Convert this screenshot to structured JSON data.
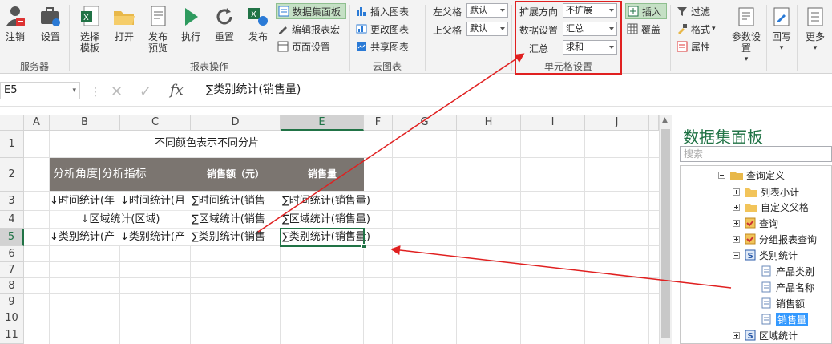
{
  "ribbon": {
    "server": {
      "logout": "注销",
      "settings": "设置",
      "group": "服务器"
    },
    "report": {
      "select_template": "选择\n模板",
      "open": "打开",
      "publish_preview": "发布\n预览",
      "execute": "执行",
      "reset": "重置",
      "publish": "发布",
      "dataset_panel": "数据集面板",
      "edit_macro": "编辑报表宏",
      "page_setup": "页面设置",
      "group": "报表操作"
    },
    "cloud": {
      "insert_chart": "插入图表",
      "change_chart": "更改图表",
      "share_chart": "共享图表",
      "group": "云图表"
    },
    "parent": {
      "left_label": "左父格",
      "left_value": "默认",
      "top_label": "上父格",
      "top_value": "默认"
    },
    "cell_settings": {
      "expand_label": "扩展方向",
      "expand_value": "不扩展",
      "data_label": "数据设置",
      "data_value": "汇总",
      "summary_label": "汇总",
      "summary_value": "求和",
      "group": "单元格设置"
    },
    "insert_cover": {
      "insert": "插入",
      "cover": "覆盖"
    },
    "filter_group": {
      "filter": "过滤",
      "format": "格式",
      "property": "属性"
    },
    "param_settings": "参数设置",
    "writeback": "回写",
    "more": "更多"
  },
  "formula_bar": {
    "cell_ref": "E5",
    "formula": "∑类别统计(销售量)"
  },
  "grid": {
    "columns": [
      "A",
      "B",
      "C",
      "D",
      "E",
      "F",
      "G",
      "H",
      "I",
      "J"
    ],
    "rows": [
      "1",
      "2",
      "3",
      "4",
      "5",
      "6",
      "7",
      "8",
      "9",
      "10",
      "11"
    ],
    "title": "不同颜色表示不同分片",
    "header_b": "分析角度|分析指标",
    "header_d": "销售额（元）",
    "header_e": "销售量",
    "r3": [
      "↓时间统计(年",
      "↓时间统计(月",
      "∑时间统计(销售",
      "∑时间统计(销售量)"
    ],
    "r4": [
      "↓区域统计(区域)",
      "∑区域统计(销售",
      "∑区域统计(销售量)"
    ],
    "r5": [
      "↓类别统计(产",
      "↓类别统计(产",
      "∑类别统计(销售",
      "∑类别统计(销售量)"
    ]
  },
  "panel": {
    "title": "数据集面板",
    "search_placeholder": "搜索",
    "tree": [
      "查询定义",
      "列表小计",
      "自定义父格",
      "查询",
      "分组报表查询",
      "类别统计",
      "产品类别",
      "产品名称",
      "销售额",
      "销售量",
      "区域统计"
    ]
  },
  "colors": {
    "accent_green": "#217346",
    "header_fill": "#7b7570",
    "highlight_red": "#e02020",
    "tree_selected": "#3399ff"
  }
}
